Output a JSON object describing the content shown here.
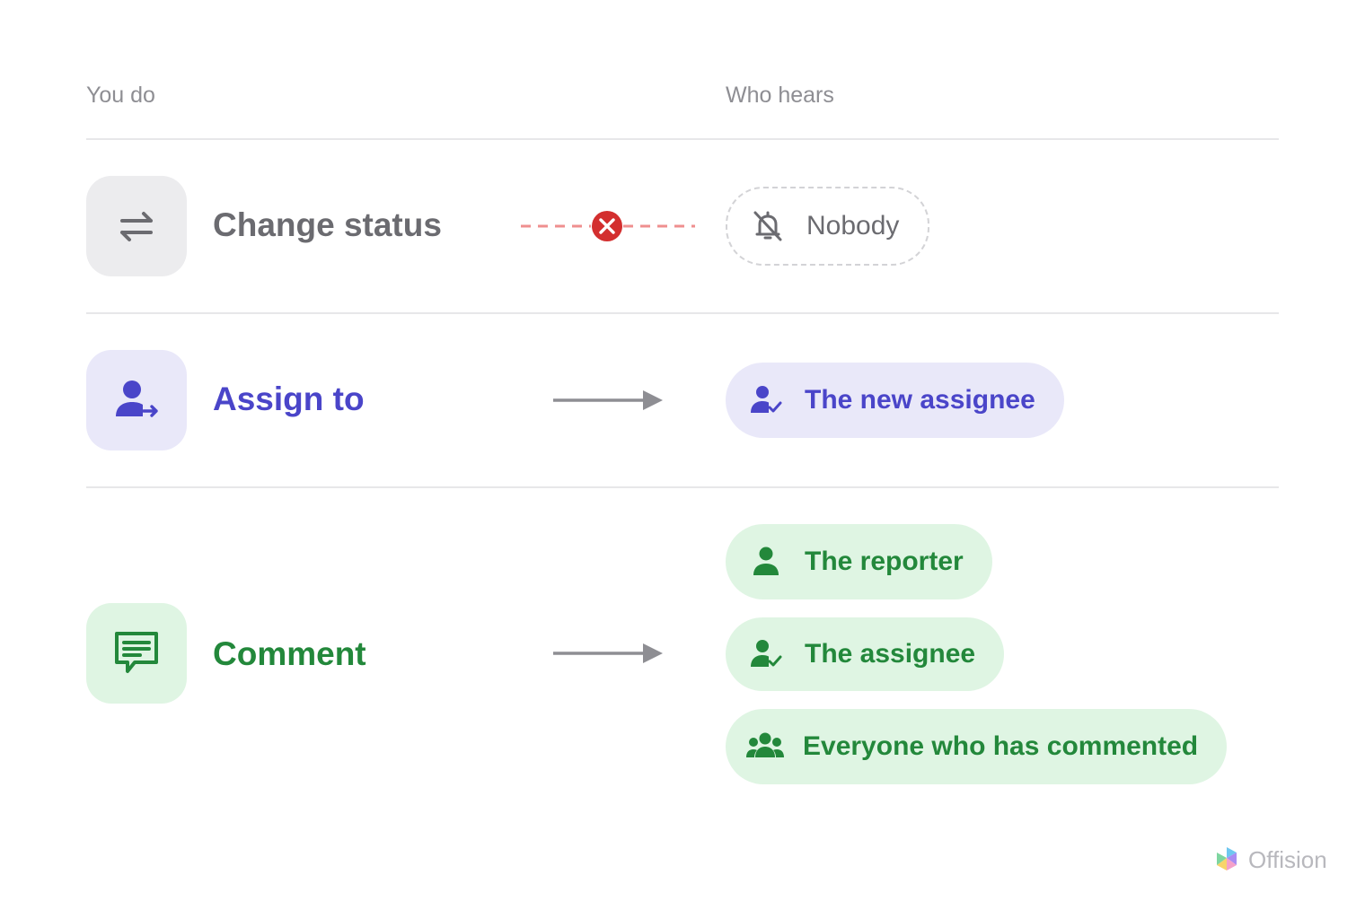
{
  "columns": {
    "left": "You do",
    "right": "Who hears"
  },
  "rows": [
    {
      "action": "Change status",
      "action_icon": "swap-arrows-icon",
      "connector": "blocked",
      "recipients": [
        {
          "label": "Nobody",
          "icon": "bell-off-icon"
        }
      ]
    },
    {
      "action": "Assign to",
      "action_icon": "assign-user-icon",
      "connector": "arrow",
      "recipients": [
        {
          "label": "The new assignee",
          "icon": "user-check-icon"
        }
      ]
    },
    {
      "action": "Comment",
      "action_icon": "comment-icon",
      "connector": "arrow",
      "recipients": [
        {
          "label": "The reporter",
          "icon": "person-icon"
        },
        {
          "label": "The assignee",
          "icon": "user-check-icon"
        },
        {
          "label": "Everyone who has commented",
          "icon": "group-icon"
        }
      ]
    }
  ],
  "colors": {
    "status_grey": "#6b6b70",
    "assign_purple": "#4a45c9",
    "assign_bg": "#e9e8f9",
    "comment_green": "#23883b",
    "comment_bg": "#dff5e3",
    "blocked_red": "#d32f2f"
  },
  "brand": {
    "name": "Offision"
  }
}
